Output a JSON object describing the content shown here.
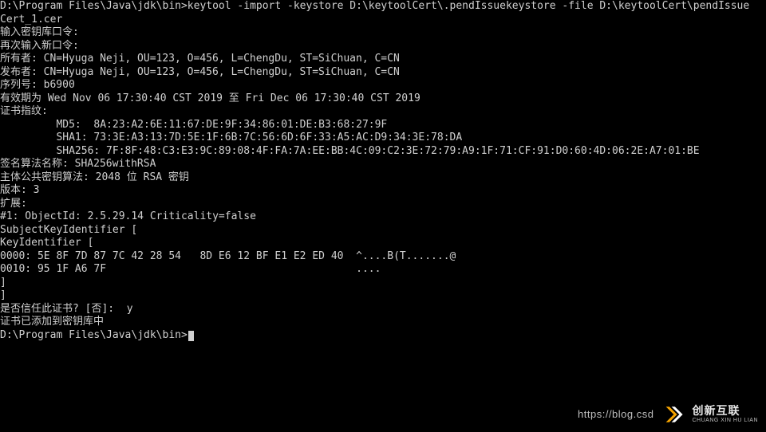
{
  "terminal": {
    "lines": [
      "D:\\Program Files\\Java\\jdk\\bin>keytool -import -keystore D:\\keytoolCert\\.pendIssuekeystore -file D:\\keytoolCert\\pendIssue",
      "Cert_1.cer",
      "输入密钥库口令:",
      "再次输入新口令:",
      "所有者: CN=Hyuga Neji, OU=123, O=456, L=ChengDu, ST=SiChuan, C=CN",
      "发布者: CN=Hyuga Neji, OU=123, O=456, L=ChengDu, ST=SiChuan, C=CN",
      "序列号: b6900",
      "有效期为 Wed Nov 06 17:30:40 CST 2019 至 Fri Dec 06 17:30:40 CST 2019",
      "证书指纹:",
      "         MD5:  8A:23:A2:6E:11:67:DE:9F:34:86:01:DE:B3:68:27:9F",
      "         SHA1: 73:3E:A3:13:7D:5E:1F:6B:7C:56:6D:6F:33:A5:AC:D9:34:3E:78:DA",
      "         SHA256: 7F:8F:48:C3:E3:9C:89:08:4F:FA:7A:EE:BB:4C:09:C2:3E:72:79:A9:1F:71:CF:91:D0:60:4D:06:2E:A7:01:BE",
      "签名算法名称: SHA256withRSA",
      "主体公共密钥算法: 2048 位 RSA 密钥",
      "版本: 3",
      "",
      "扩展:",
      "",
      "#1: ObjectId: 2.5.29.14 Criticality=false",
      "SubjectKeyIdentifier [",
      "KeyIdentifier [",
      "0000: 5E 8F 7D 87 7C 42 28 54   8D E6 12 BF E1 E2 ED 40  ^....B(T.......@",
      "0010: 95 1F A6 7F                                        ....",
      "]",
      "]",
      "",
      "是否信任此证书? [否]:  y",
      "证书已添加到密钥库中",
      "",
      "D:\\Program Files\\Java\\jdk\\bin>"
    ]
  },
  "watermark": {
    "url": "https://blog.csd",
    "brand_cn": "创新互联",
    "brand_py": "CHUANG XIN HU LIAN",
    "logo_color1": "#f5a300",
    "logo_color2": "#ffffff"
  }
}
